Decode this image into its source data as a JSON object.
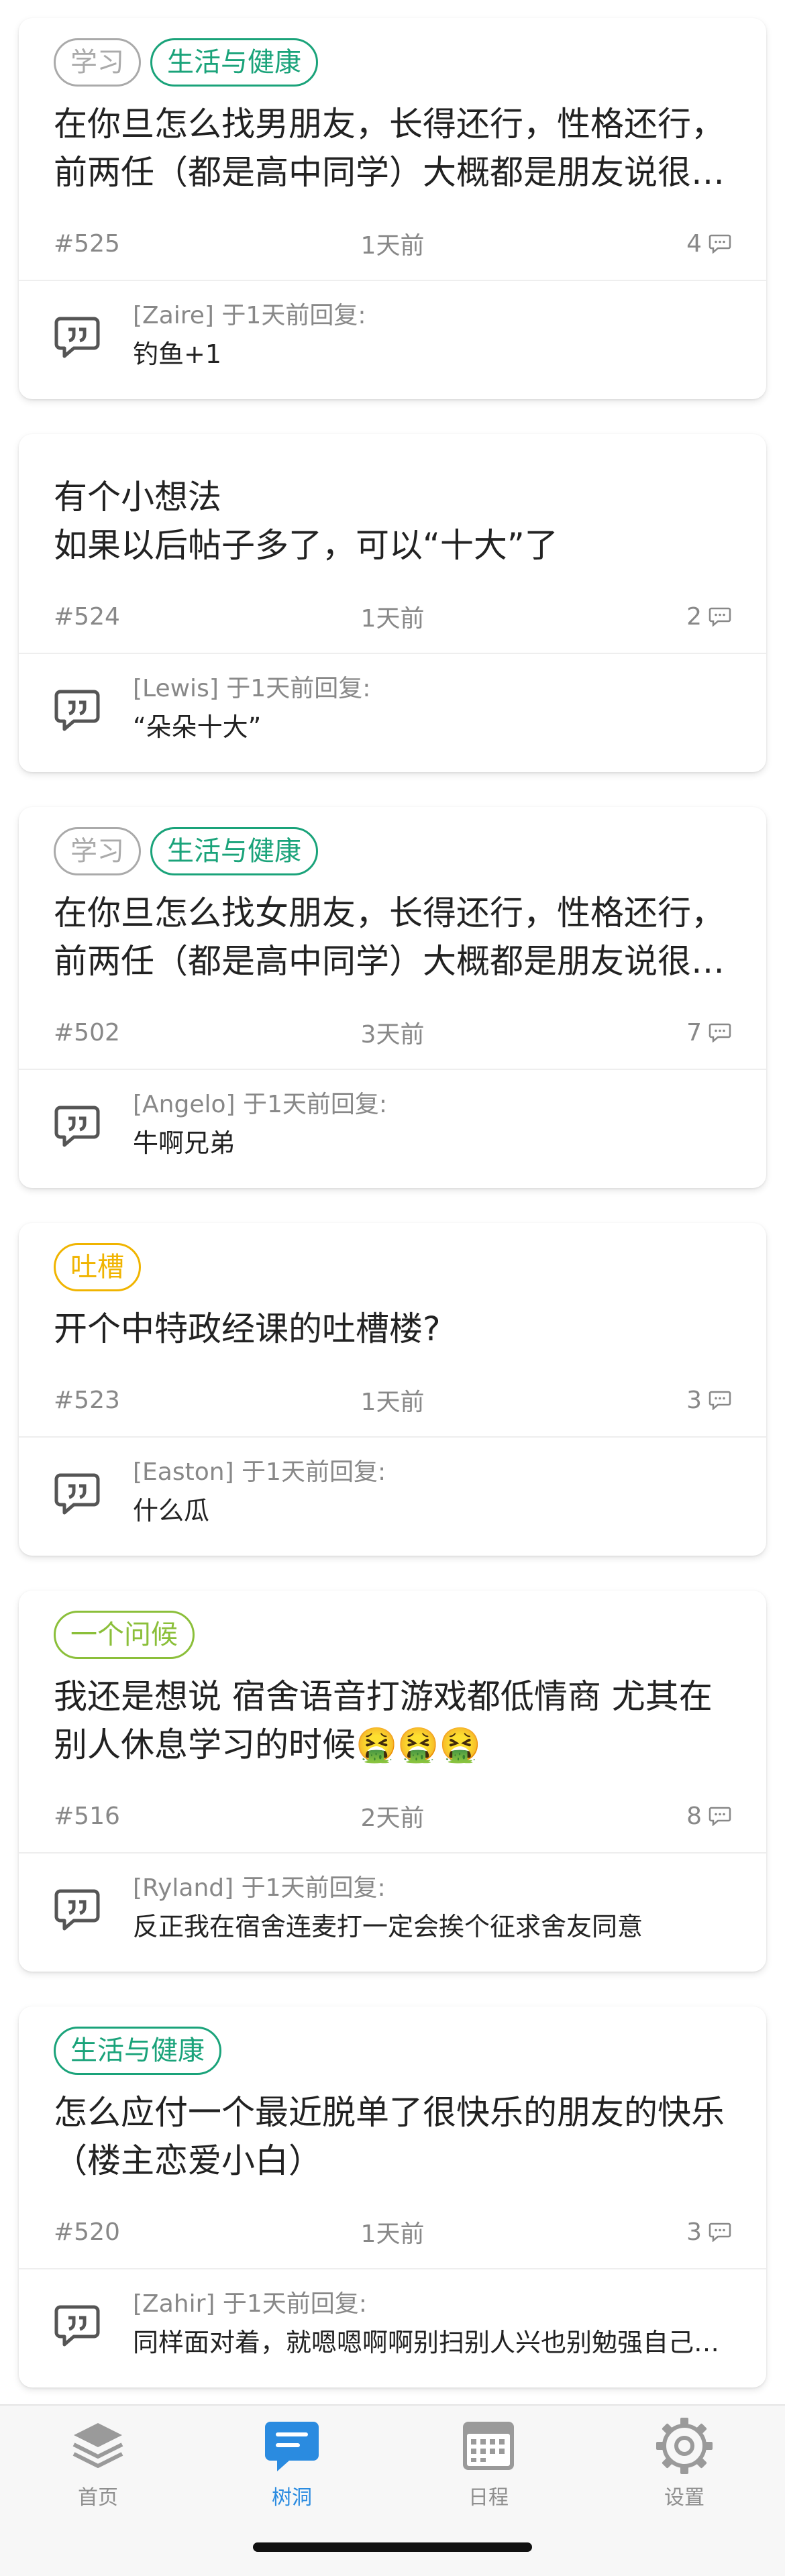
{
  "posts": [
    {
      "tags": [
        {
          "label": "学习",
          "color": "#aaaaaa"
        },
        {
          "label": "生活与健康",
          "color": "#1aa37a"
        }
      ],
      "lines": [
        "在你旦怎么找男朋友，长得还行，性格还行，",
        "前两任（都是高中同学）大概都是朋友说很…"
      ],
      "id": "#525",
      "time": "1天前",
      "count": "4",
      "reply": {
        "head": "[Zaire] 于1天前回复:",
        "text": "钓鱼+1"
      }
    },
    {
      "tags": [],
      "lines": [
        "有个小想法",
        "如果以后帖子多了，可以“十大”了"
      ],
      "id": "#524",
      "time": "1天前",
      "count": "2",
      "reply": {
        "head": "[Lewis] 于1天前回复:",
        "text": "“朵朵十大”"
      }
    },
    {
      "tags": [
        {
          "label": "学习",
          "color": "#aaaaaa"
        },
        {
          "label": "生活与健康",
          "color": "#1aa37a"
        }
      ],
      "lines": [
        "在你旦怎么找女朋友，长得还行，性格还行，",
        "前两任（都是高中同学）大概都是朋友说很…"
      ],
      "id": "#502",
      "time": "3天前",
      "count": "7",
      "reply": {
        "head": "[Angelo] 于1天前回复:",
        "text": "牛啊兄弟"
      }
    },
    {
      "tags": [
        {
          "label": "吐槽",
          "color": "#f0b400"
        }
      ],
      "lines": [
        "开个中特政经课的吐槽楼?"
      ],
      "id": "#523",
      "time": "1天前",
      "count": "3",
      "reply": {
        "head": "[Easton] 于1天前回复:",
        "text": "什么瓜"
      }
    },
    {
      "tags": [
        {
          "label": "一个问候",
          "color": "#8bbf3a"
        }
      ],
      "lines": [
        "我还是想说 宿舍语音打游戏都低情商 尤其在",
        "别人休息学习的时候🤮🤮🤮"
      ],
      "id": "#516",
      "time": "2天前",
      "count": "8",
      "reply": {
        "head": "[Ryland] 于1天前回复:",
        "text": "反正我在宿舍连麦打一定会挨个征求舍友同意"
      }
    },
    {
      "tags": [
        {
          "label": "生活与健康",
          "color": "#1aa37a"
        }
      ],
      "lines": [
        "怎么应付一个最近脱单了很快乐的朋友的快乐",
        "（楼主恋爱小白）"
      ],
      "id": "#520",
      "time": "1天前",
      "count": "3",
      "reply": {
        "head": "[Zahir] 于1天前回复:",
        "text": "同样面对着，就嗯嗯啊啊别扫别人兴也别勉强自己…"
      }
    }
  ],
  "tabbar": {
    "active_color": "#2a8be0",
    "inactive_color": "#8f8f8f",
    "items": [
      {
        "label": "首页",
        "icon": "layers-icon",
        "active": false
      },
      {
        "label": "树洞",
        "icon": "chat-bubble-icon",
        "active": true
      },
      {
        "label": "日程",
        "icon": "calendar-icon",
        "active": false
      },
      {
        "label": "设置",
        "icon": "gear-icon",
        "active": false
      }
    ]
  }
}
